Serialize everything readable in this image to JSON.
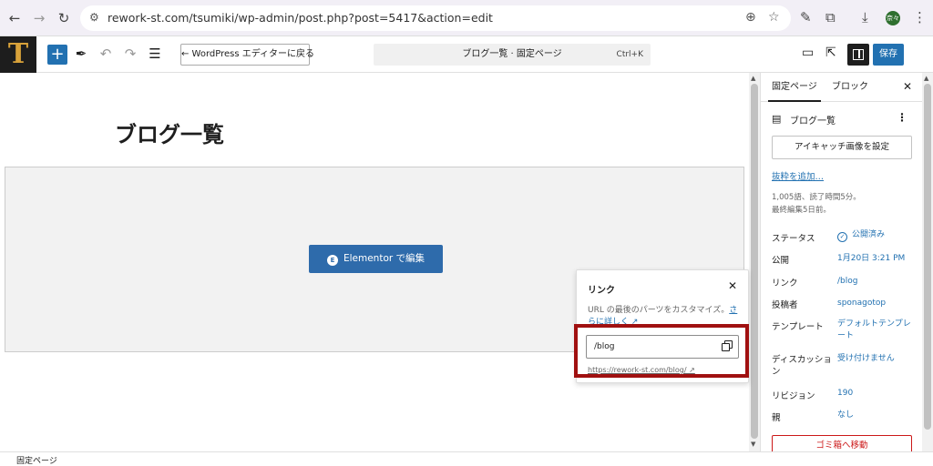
{
  "browser": {
    "url": "rework-st.com/tsumiki/wp-admin/post.php?post=5417&action=edit",
    "profile_initials": "奈々"
  },
  "header": {
    "logo_letter": "T",
    "back_label": "← WordPress エディターに戻る",
    "command_title": "ブログ一覧 · 固定ページ",
    "command_shortcut": "Ctrl+K",
    "save_label": "保存"
  },
  "canvas": {
    "page_title": "ブログ一覧",
    "elementor_icon": "E",
    "elementor_button": "Elementor で編集"
  },
  "link_popover": {
    "title": "リンク",
    "help_text": "URL の最後のパーツをカスタマイズ。",
    "help_link": "さらに詳しく ↗",
    "slug_value": "/blog",
    "full_url": "https://rework-st.com/blog/ ↗"
  },
  "sidebar": {
    "tabs": [
      {
        "label": "固定ページ"
      },
      {
        "label": "ブロック"
      }
    ],
    "doc_title": "ブログ一覧",
    "featured_image_button": "アイキャッチ画像を設定",
    "excerpt_link": "抜粋を追加…",
    "word_count": "1,005語、読了時間5分。",
    "last_edited": "最終編集5日前。",
    "rows": [
      {
        "label": "ステータス",
        "value": "公開済み"
      },
      {
        "label": "公開",
        "value": "1月20日 3:21 PM"
      },
      {
        "label": "リンク",
        "value": "/blog"
      },
      {
        "label": "投稿者",
        "value": "sponagotop"
      },
      {
        "label": "テンプレート",
        "value": "デフォルトテンプレート"
      },
      {
        "label": "ディスカッション",
        "value": "受け付けません"
      },
      {
        "label": "リビジョン",
        "value": "190"
      },
      {
        "label": "親",
        "value": "なし"
      }
    ],
    "trash_button": "ゴミ箱へ移動"
  },
  "footer": {
    "breadcrumb": "固定ページ"
  },
  "colors": {
    "accent": "#2271b1",
    "highlight": "#a01010",
    "danger": "#cc1818"
  }
}
